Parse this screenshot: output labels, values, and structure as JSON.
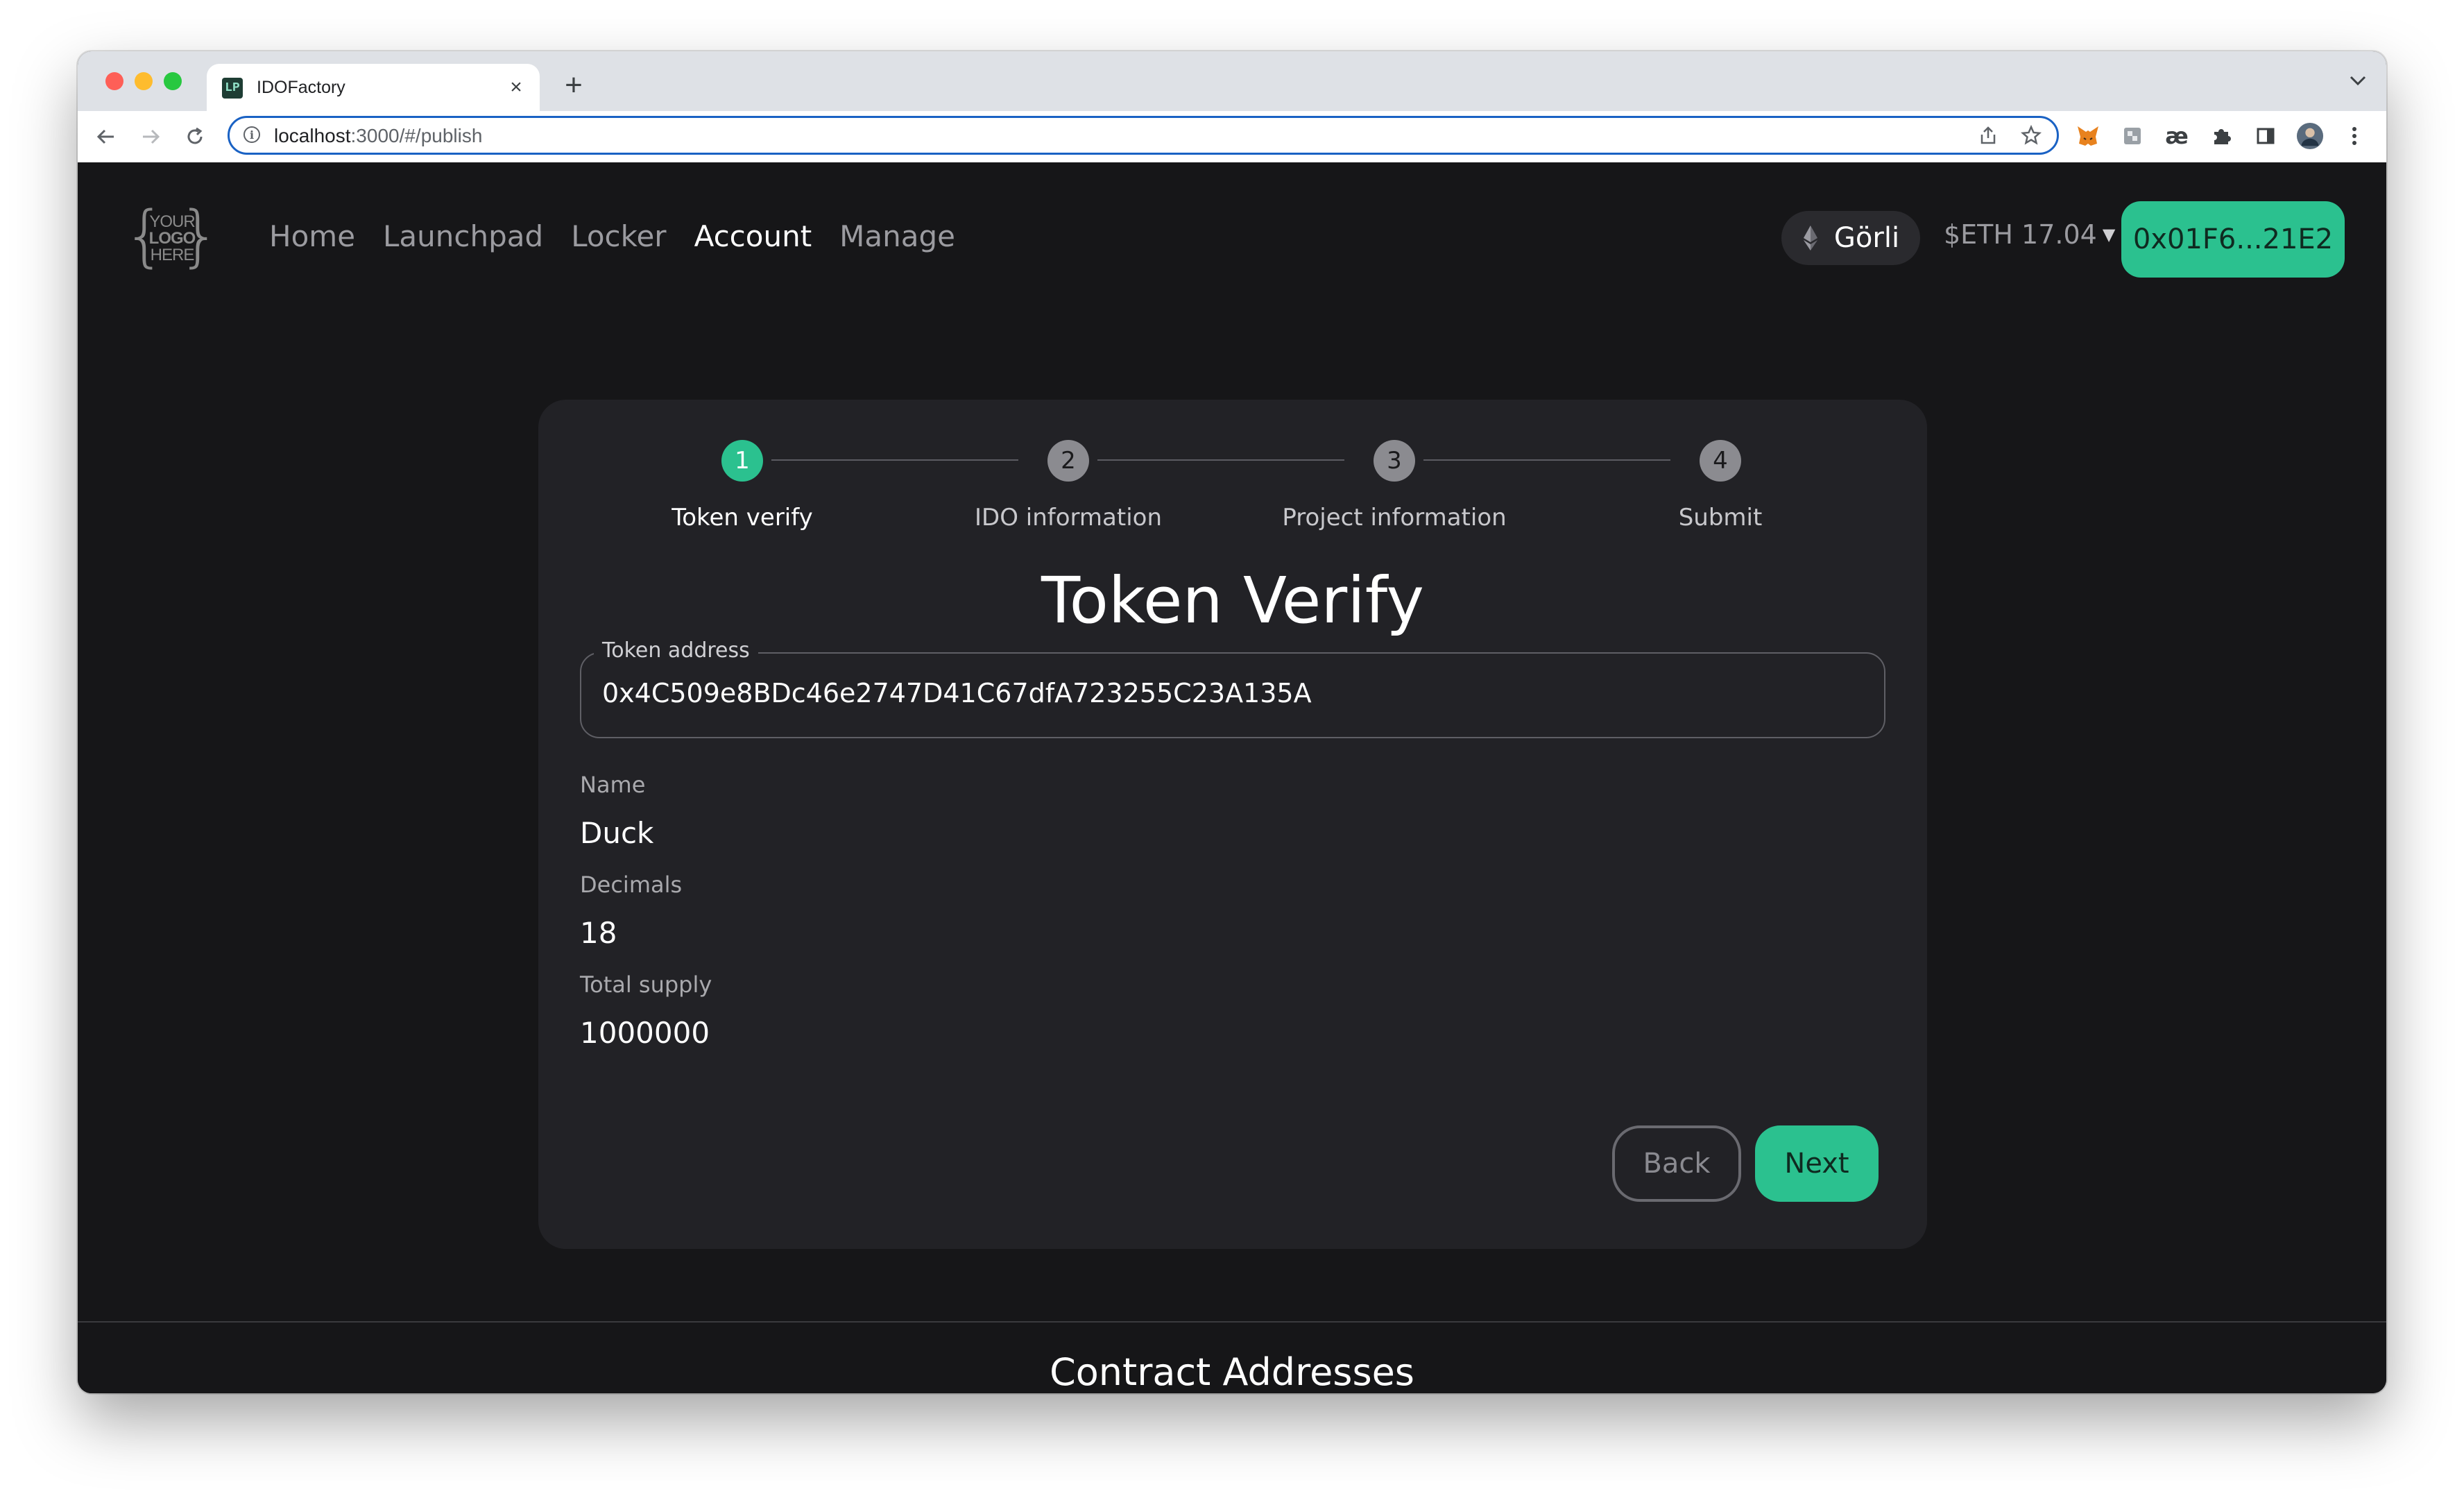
{
  "browser": {
    "tab_title": "IDOFactory",
    "tab_favicon_text": "LP",
    "url_host": "localhost",
    "url_rest": ":3000/#/publish",
    "new_tab_symbol": "+",
    "close_symbol": "×"
  },
  "navbar": {
    "logo_lines": [
      "YOUR",
      "LOGO",
      "HERE"
    ],
    "links": [
      {
        "label": "Home",
        "active": false
      },
      {
        "label": "Launchpad",
        "active": false
      },
      {
        "label": "Locker",
        "active": false
      },
      {
        "label": "Account",
        "active": true
      },
      {
        "label": "Manage",
        "active": false
      }
    ],
    "network": "Görli",
    "balance": "$ETH 17.04",
    "wallet": "0x01F6...21E2"
  },
  "stepper": {
    "steps": [
      {
        "number": "1",
        "label": "Token verify",
        "active": true
      },
      {
        "number": "2",
        "label": "IDO information",
        "active": false
      },
      {
        "number": "3",
        "label": "Project information",
        "active": false
      },
      {
        "number": "4",
        "label": "Submit",
        "active": false
      }
    ]
  },
  "form": {
    "title": "Token Verify",
    "token_address_label": "Token address",
    "token_address_value": "0x4C509e8BDc46e2747D41C67dfA723255C23A135A",
    "name_label": "Name",
    "name_value": "Duck",
    "decimals_label": "Decimals",
    "decimals_value": "18",
    "supply_label": "Total supply",
    "supply_value": "1000000",
    "back_label": "Back",
    "next_label": "Next"
  },
  "footer": {
    "title": "Contract Addresses"
  },
  "colors": {
    "accent": "#2bc18f",
    "page_bg": "#161618",
    "card_bg": "#222226"
  }
}
